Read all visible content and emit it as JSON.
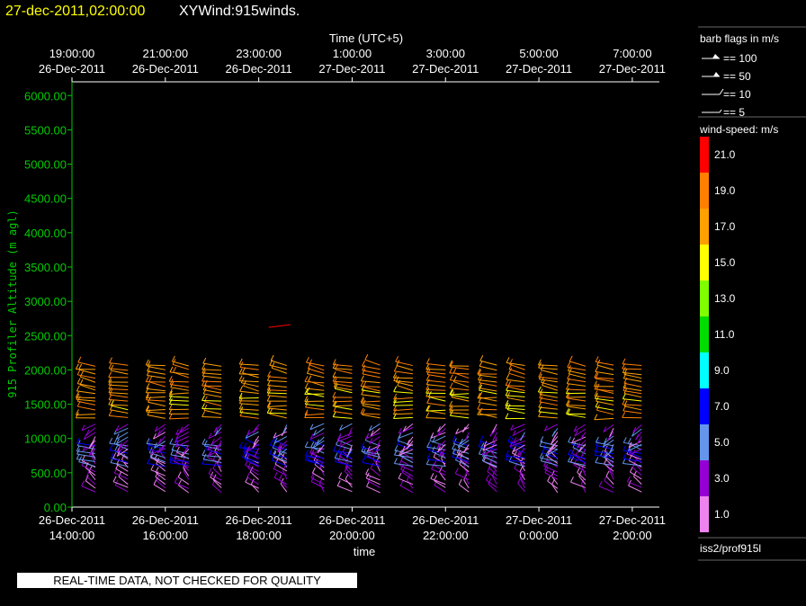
{
  "header": {
    "date_label": "27-dec-2011,02:00:00",
    "title": "XYWind:915winds."
  },
  "chart_data": {
    "type": "scatter",
    "title": "XYWind:915winds.",
    "xlabel": "time",
    "x_top_label": "Time (UTC+5)",
    "ylabel": "915 Profiler Altitude (m agl)",
    "ylim": [
      0,
      6200
    ],
    "yticks": [
      "0.00",
      "500.00",
      "1000.00",
      "1500.00",
      "2000.00",
      "2500.00",
      "3000.00",
      "3500.00",
      "4000.00",
      "4500.00",
      "5000.00",
      "5500.00",
      "6000.00"
    ],
    "xlim": [
      "26-Dec-2011 14:00:00",
      "27-Dec-2011 02:35:00"
    ],
    "x_ticks_bottom": [
      {
        "date": "26-Dec-2011",
        "time": "14:00:00"
      },
      {
        "date": "26-Dec-2011",
        "time": "16:00:00"
      },
      {
        "date": "26-Dec-2011",
        "time": "18:00:00"
      },
      {
        "date": "26-Dec-2011",
        "time": "20:00:00"
      },
      {
        "date": "26-Dec-2011",
        "time": "22:00:00"
      },
      {
        "date": "27-Dec-2011",
        "time": "0:00:00"
      },
      {
        "date": "27-Dec-2011",
        "time": "2:00:00"
      }
    ],
    "x_ticks_top": [
      {
        "time": "19:00:00",
        "date": "26-Dec-2011"
      },
      {
        "time": "21:00:00",
        "date": "26-Dec-2011"
      },
      {
        "time": "23:00:00",
        "date": "26-Dec-2011"
      },
      {
        "time": "1:00:00",
        "date": "27-Dec-2011"
      },
      {
        "time": "3:00:00",
        "date": "27-Dec-2011"
      },
      {
        "time": "5:00:00",
        "date": "27-Dec-2011"
      },
      {
        "time": "7:00:00",
        "date": "27-Dec-2011"
      }
    ],
    "barb_legend": {
      "title": "barb flags in m/s",
      "items": [
        "== 100",
        "== 50",
        "== 10",
        "== 5"
      ]
    },
    "colorbar": {
      "title": "wind-speed: m/s",
      "labels": [
        "21.0",
        "19.0",
        "17.0",
        "15.0",
        "13.0",
        "11.0",
        "9.0",
        "7.0",
        "5.0",
        "3.0",
        "1.0"
      ],
      "colors": [
        "#ff0000",
        "#ff7f00",
        "#ffa000",
        "#ffff00",
        "#7fff00",
        "#00dd00",
        "#00ffff",
        "#0000ff",
        "#6495ed",
        "#9400d3",
        "#ee82ee"
      ]
    },
    "source": "iss2/prof915l",
    "qc_note": "REAL-TIME DATA, NOT CHECKED FOR QUALITY",
    "profile_times_hours": [
      -0.3,
      0.5,
      1.2,
      2.0,
      2.5,
      3.2,
      4.0,
      4.6,
      5.4,
      6.0,
      6.6,
      7.3,
      8.0,
      8.5,
      9.1,
      9.7,
      10.4,
      11.0,
      11.6,
      12.2
    ],
    "barb_levels": [
      {
        "alt_min": 220,
        "alt_max": 700,
        "step": 60,
        "speed": 2,
        "dir": 330
      },
      {
        "alt_min": 600,
        "alt_max": 900,
        "step": 60,
        "speed": 6,
        "dir": 300
      },
      {
        "alt_min": 850,
        "alt_max": 1250,
        "step": 60,
        "speed": 3,
        "dir": 210
      },
      {
        "alt_min": 1300,
        "alt_max": 1700,
        "step": 60,
        "speed": 17,
        "dir": 280
      },
      {
        "alt_min": 1700,
        "alt_max": 2100,
        "step": 60,
        "speed": 18,
        "dir": 290
      }
    ]
  }
}
